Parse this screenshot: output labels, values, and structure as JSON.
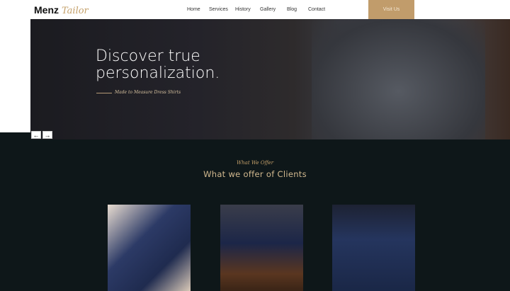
{
  "header": {
    "logo_main": "Menz",
    "logo_script": "Tailor",
    "nav": [
      "Home",
      "Services",
      "History",
      "Gallery",
      "Blog",
      "Contact"
    ],
    "cta": "Visit Us"
  },
  "hero": {
    "title_line1": "Discover true",
    "title_line2": "personalization.",
    "subtitle": "Made to Measure Dress Shirts",
    "prev_icon": "arrow-left-icon",
    "next_icon": "arrow-right-icon",
    "prev": "←",
    "next": "→"
  },
  "offer": {
    "kicker": "What We Offer",
    "title": "What we offer of Clients"
  },
  "colors": {
    "accent": "#c19c6b",
    "dark_bg": "#0e1719"
  }
}
